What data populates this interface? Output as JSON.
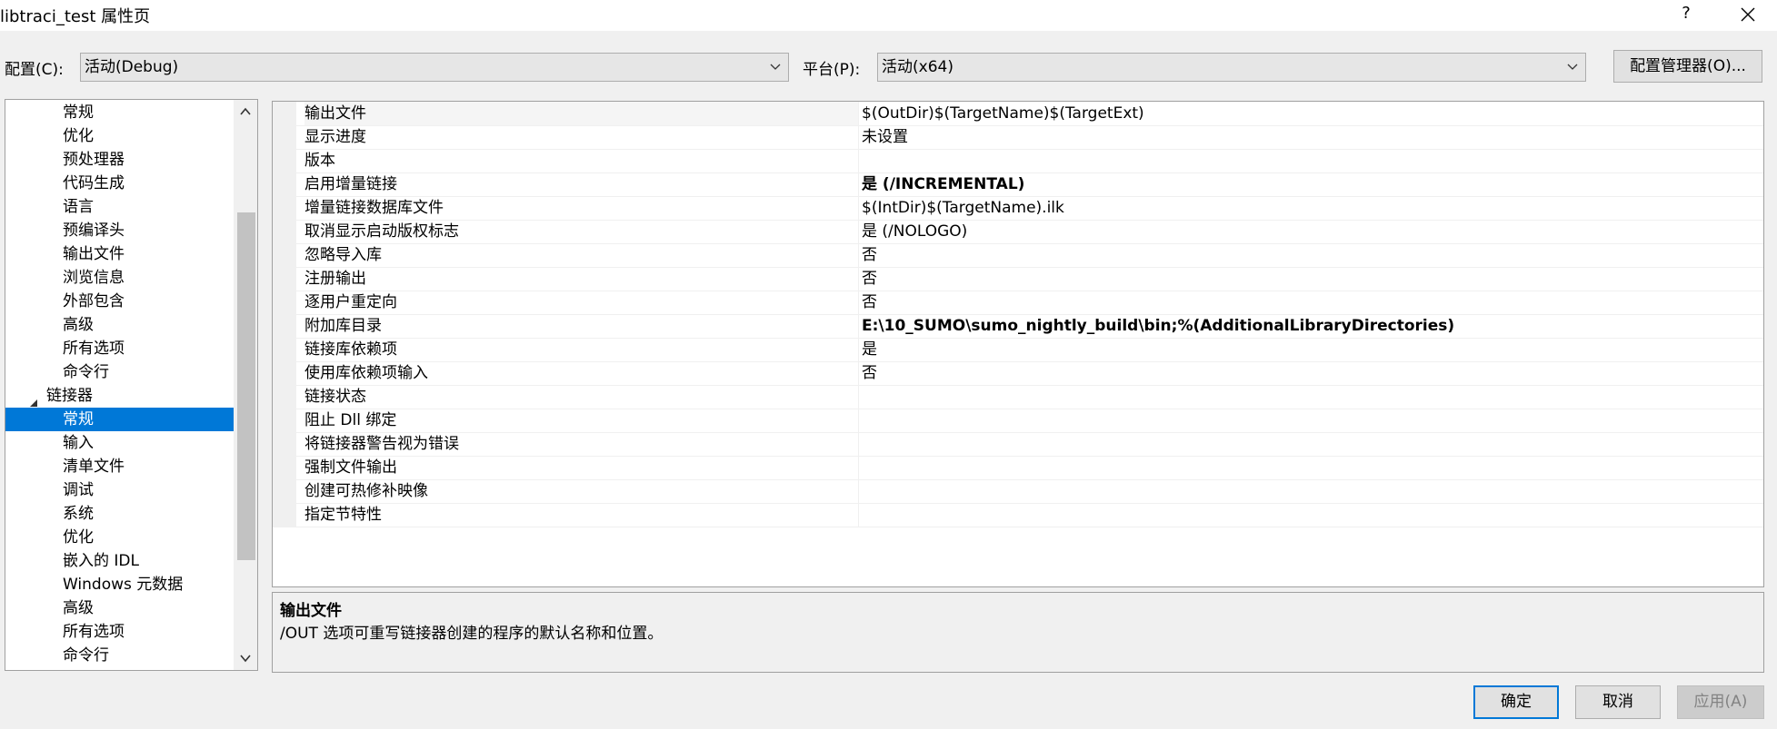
{
  "window": {
    "title": "libtraci_test 属性页",
    "help_label": "?"
  },
  "config": {
    "config_label": "配置(C):",
    "config_value": "活动(Debug)",
    "platform_label": "平台(P):",
    "platform_value": "活动(x64)",
    "manager_button": "配置管理器(O)..."
  },
  "tree": {
    "items": [
      {
        "label": "常规"
      },
      {
        "label": "优化"
      },
      {
        "label": "预处理器"
      },
      {
        "label": "代码生成"
      },
      {
        "label": "语言"
      },
      {
        "label": "预编译头"
      },
      {
        "label": "输出文件"
      },
      {
        "label": "浏览信息"
      },
      {
        "label": "外部包含"
      },
      {
        "label": "高级"
      },
      {
        "label": "所有选项"
      },
      {
        "label": "命令行"
      },
      {
        "label": "链接器"
      },
      {
        "label": "常规"
      },
      {
        "label": "输入"
      },
      {
        "label": "清单文件"
      },
      {
        "label": "调试"
      },
      {
        "label": "系统"
      },
      {
        "label": "优化"
      },
      {
        "label": "嵌入的 IDL"
      },
      {
        "label": "Windows 元数据"
      },
      {
        "label": "高级"
      },
      {
        "label": "所有选项"
      },
      {
        "label": "命令行"
      }
    ]
  },
  "grid": {
    "rows": [
      {
        "name": "输出文件",
        "value": "$(OutDir)$(TargetName)$(TargetExt)"
      },
      {
        "name": "显示进度",
        "value": "未设置"
      },
      {
        "name": "版本",
        "value": ""
      },
      {
        "name": "启用增量链接",
        "value": "是 (/INCREMENTAL)"
      },
      {
        "name": "增量链接数据库文件",
        "value": "$(IntDir)$(TargetName).ilk"
      },
      {
        "name": "取消显示启动版权标志",
        "value": "是 (/NOLOGO)"
      },
      {
        "name": "忽略导入库",
        "value": "否"
      },
      {
        "name": "注册输出",
        "value": "否"
      },
      {
        "name": "逐用户重定向",
        "value": "否"
      },
      {
        "name": "附加库目录",
        "value": "E:\\10_SUMO\\sumo_nightly_build\\bin;%(AdditionalLibraryDirectories)"
      },
      {
        "name": "链接库依赖项",
        "value": "是"
      },
      {
        "name": "使用库依赖项输入",
        "value": "否"
      },
      {
        "name": "链接状态",
        "value": ""
      },
      {
        "name": "阻止 Dll 绑定",
        "value": ""
      },
      {
        "name": "将链接器警告视为错误",
        "value": ""
      },
      {
        "name": "强制文件输出",
        "value": ""
      },
      {
        "name": "创建可热修补映像",
        "value": ""
      },
      {
        "name": "指定节特性",
        "value": ""
      }
    ]
  },
  "description": {
    "title": "输出文件",
    "text": "/OUT 选项可重写链接器创建的程序的默认名称和位置。"
  },
  "buttons": {
    "ok": "确定",
    "cancel": "取消",
    "apply": "应用(A)"
  },
  "colors": {
    "selection": "#0078d7",
    "background": "#f0f0f0"
  }
}
